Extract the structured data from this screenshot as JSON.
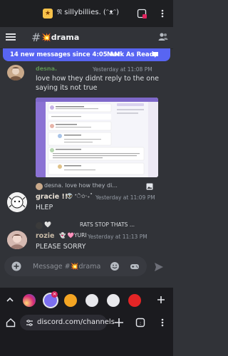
{
  "browser": {
    "tab_title": "𝔑 sillybillies. (ᵔᴥᵔ)",
    "url": "discord.com/channels"
  },
  "channel": {
    "name": "💥drama"
  },
  "banner": {
    "text": "14 new messages since 4:05 AM",
    "action": "Mark As Read"
  },
  "messages": [
    {
      "author": "desna.",
      "time": "Yesterday at 11:08 PM",
      "text": "love how they didnt reply to the one saying its not true"
    },
    {
      "reply_preview": "desna.  love how they di...",
      "author": "gracie !!",
      "badge": "👽 *ੈ✩‧₊˚",
      "time": "Yesterday at 11:09 PM",
      "text": "HLEP"
    },
    {
      "reply_preview": "🤍",
      "reply_tag": "RATS  STOP THATS ...",
      "author": "rozie",
      "badge": "👻 🩷YURI",
      "time": "Yesterday at 11:13 PM",
      "text": "PLEASE SORRY"
    }
  ],
  "composer": {
    "placeholder": "Message #💥drama"
  },
  "colors": {
    "accent": "#5865f2",
    "background": "#313338"
  }
}
